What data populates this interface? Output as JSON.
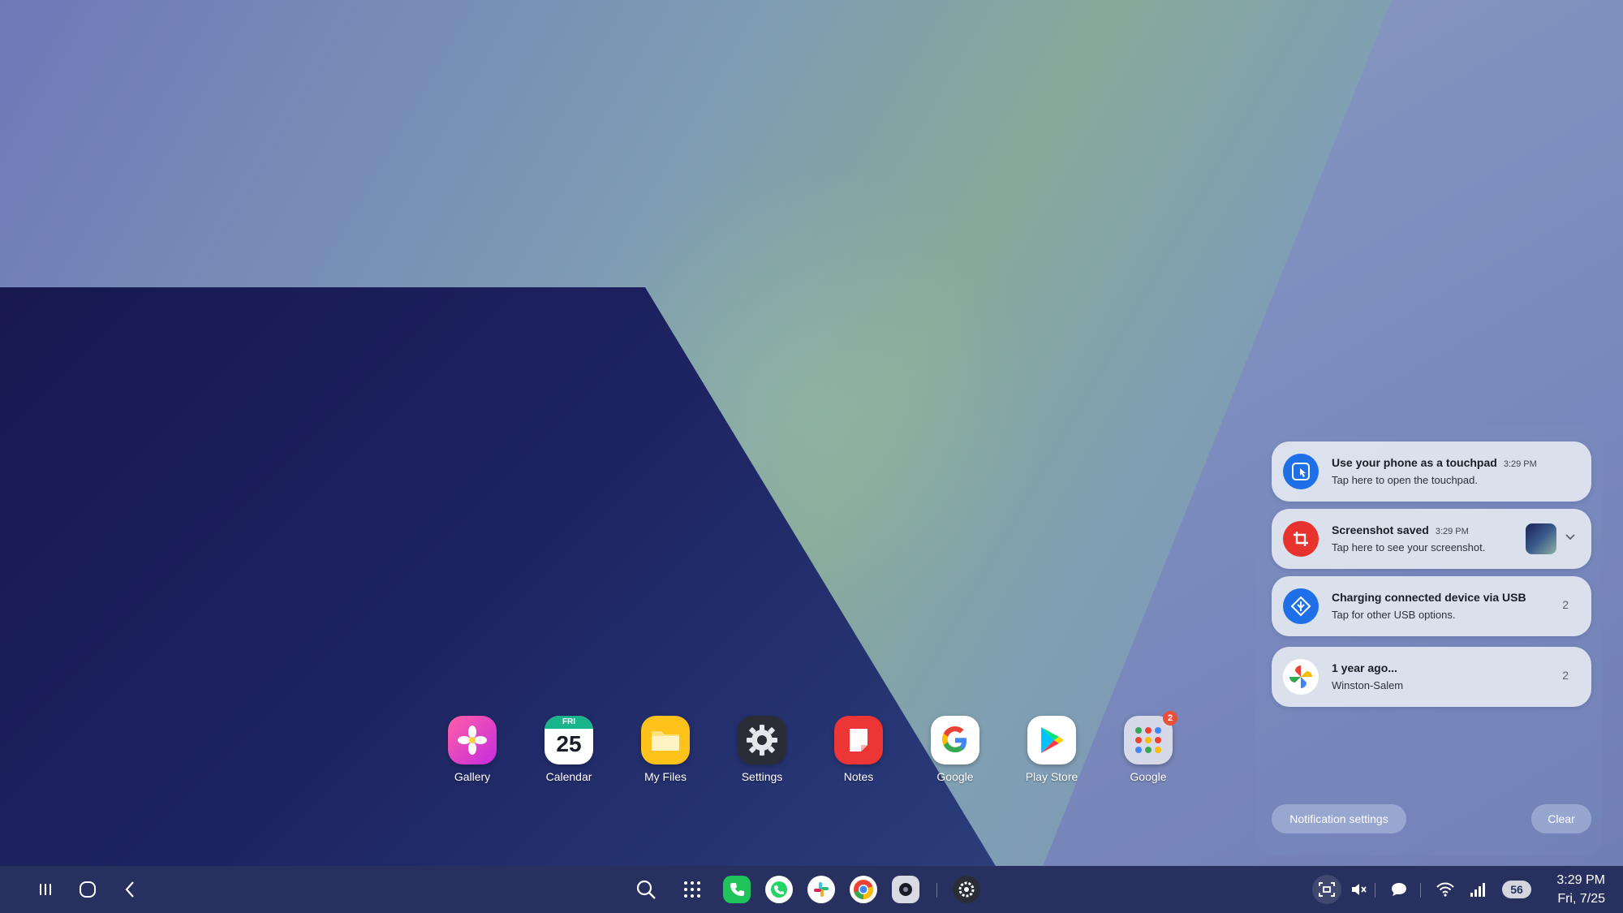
{
  "dock": {
    "apps": [
      {
        "label": "Gallery",
        "icon": "gallery-icon"
      },
      {
        "label": "Calendar",
        "icon": "calendar-icon",
        "day_name": "FRI",
        "day": "25"
      },
      {
        "label": "My Files",
        "icon": "folder-icon"
      },
      {
        "label": "Settings",
        "icon": "gear-icon"
      },
      {
        "label": "Notes",
        "icon": "notes-icon"
      },
      {
        "label": "Google",
        "icon": "google-icon"
      },
      {
        "label": "Play Store",
        "icon": "play-store-icon"
      },
      {
        "label": "Google",
        "icon": "app-folder-icon",
        "badge": "2"
      }
    ]
  },
  "notifications": {
    "items": [
      {
        "title": "Use your phone as a touchpad",
        "time": "3:29 PM",
        "body": "Tap here to open the touchpad.",
        "icon": "touchpad-icon",
        "icon_color": "#1f6fe8"
      },
      {
        "title": "Screenshot saved",
        "time": "3:29 PM",
        "body": "Tap here to see your screenshot.",
        "icon": "screenshot-icon",
        "icon_color": "#e8322e"
      },
      {
        "title": "Charging connected device via USB",
        "body": "Tap for other USB options.",
        "count": "2",
        "icon": "usb-icon",
        "icon_color": "#1f6fe8"
      },
      {
        "title": "1 year ago...",
        "body": "Winston-Salem",
        "count": "2",
        "icon": "google-photos-icon"
      }
    ],
    "settings_label": "Notification settings",
    "clear_label": "Clear"
  },
  "taskbar": {
    "nav": [
      "recents-icon",
      "home-icon",
      "back-icon"
    ],
    "apps": [
      "search-icon",
      "apps-grid-icon",
      "phone-icon",
      "whatsapp-icon",
      "slack-icon",
      "chrome-icon",
      "camera-icon",
      "settings-icon"
    ],
    "status": [
      "screen-capture-icon",
      "mute-icon",
      "chat-icon",
      "wifi-icon",
      "signal-icon"
    ],
    "battery": "56",
    "time": "3:29 PM",
    "date": "Fri, 7/25"
  }
}
